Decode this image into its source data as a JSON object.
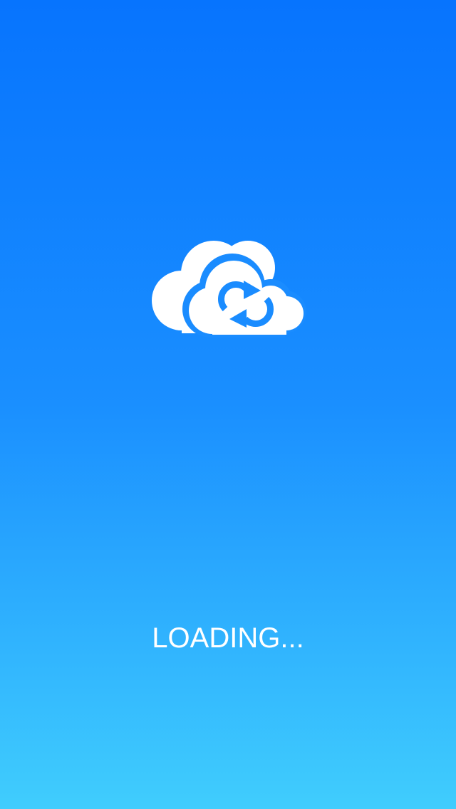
{
  "app": {
    "status_text": "LOADING...",
    "logo_icon": "cloud-sync-icon",
    "colors": {
      "background_top": "#0774fe",
      "background_bottom": "#40cdfd",
      "foreground": "#ffffff",
      "accent": "#1a8cff"
    }
  }
}
